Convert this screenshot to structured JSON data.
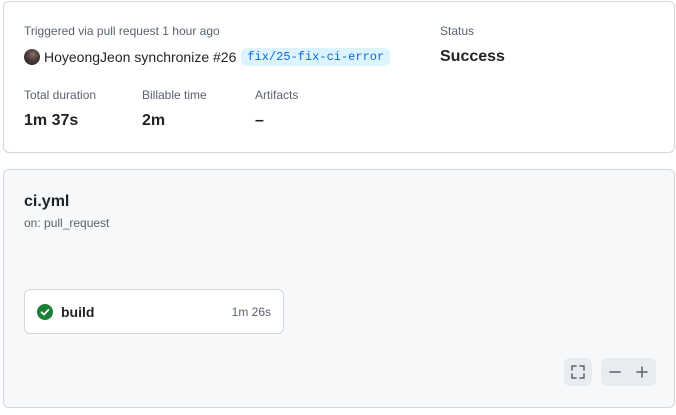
{
  "summary": {
    "triggered_text": "Triggered via pull request 1 hour ago",
    "actor": "HoyeongJeon",
    "event_text": "synchronize #26",
    "branch": "fix/25-fix-ci-error",
    "status_label": "Status",
    "status_value": "Success",
    "total_duration_label": "Total duration",
    "total_duration_value": "1m 37s",
    "billable_time_label": "Billable time",
    "billable_time_value": "2m",
    "artifacts_label": "Artifacts",
    "artifacts_value": "–"
  },
  "workflow": {
    "file": "ci.yml",
    "trigger": "on: pull_request",
    "jobs": [
      {
        "name": "build",
        "duration": "1m 26s",
        "status": "success"
      }
    ]
  },
  "graph_controls": {
    "icons": [
      "fullscreen-icon",
      "zoom-out-icon",
      "zoom-in-icon"
    ]
  },
  "colors": {
    "success": "#1a7f37",
    "branch_text": "#0969da",
    "branch_bg": "#ddf4ff",
    "border": "#d0d7de",
    "graph_bg": "#f6f8fa"
  }
}
